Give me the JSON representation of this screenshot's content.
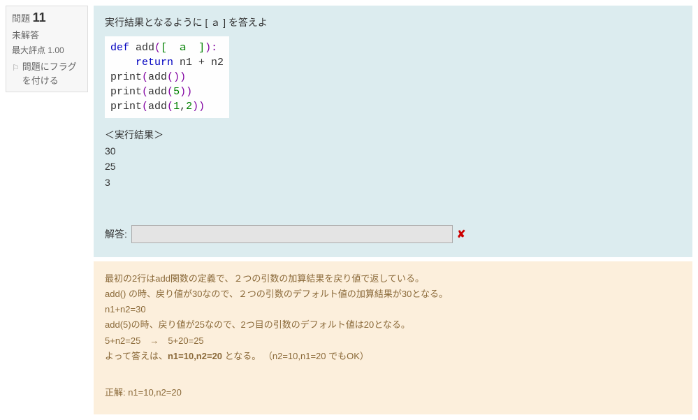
{
  "sidebar": {
    "q_label": "問題",
    "q_number": "11",
    "status": "未解答",
    "grade_label": "最大評点 1.00",
    "flag_text": "問題にフラグを付ける"
  },
  "question": {
    "instruction": "実行結果となるように [ ａ ] を答えよ",
    "code": {
      "line1_def": "def",
      "line1_fn": " add",
      "line1_open": "(",
      "line1_bracket": "[　ａ　]",
      "line1_close": "):",
      "line2_ret": "    return",
      "line2_expr": " n1 + n2",
      "line3_print": "print",
      "line3_open": "(",
      "line3_call": "add",
      "line3_args_open": "(",
      "line3_args_close": ")",
      "line3_close": ")",
      "line4_print": "print",
      "line4_open": "(",
      "line4_call": "add",
      "line4_args_open": "(",
      "line4_arg1": "5",
      "line4_args_close": ")",
      "line4_close": ")",
      "line5_print": "print",
      "line5_open": "(",
      "line5_call": "add",
      "line5_args_open": "(",
      "line5_arg1": "1",
      "line5_comma": ",",
      "line5_arg2": "2",
      "line5_args_close": ")",
      "line5_close": ")"
    },
    "exec_label": "＜実行結果＞",
    "exec_output": "30\n25\n3",
    "answer_label": "解答:",
    "answer_value": ""
  },
  "feedback": {
    "line1": "最初の2行はadd関数の定義で、２つの引数の加算結果を戻り値で返している。",
    "line2": "add() の時、戻り値が30なので、２つの引数のデフォルト値の加算結果が30となる。",
    "line3": "n1+n2=30",
    "line4": "add(5)の時、戻り値が25なので、2つ目の引数のデフォルト値は20となる。",
    "line5": "5+n2=25　→　5+20=25",
    "line6_pre": "よって答えは、",
    "line6_bold": "n1=10,n2=20",
    "line6_post": " となる。 （n2=10,n1=20 でもOK）",
    "correct_label": "正解: n1=10,n2=20"
  }
}
